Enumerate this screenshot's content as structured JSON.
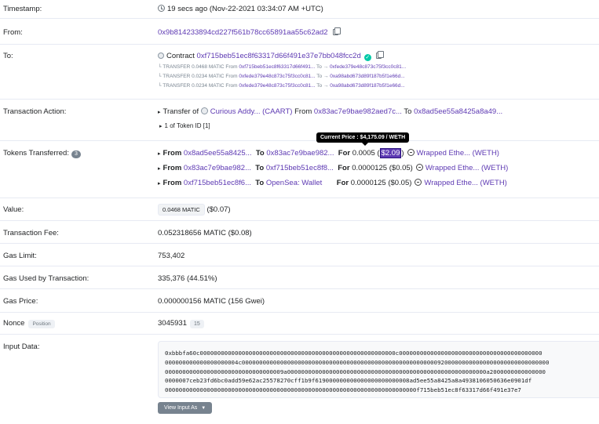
{
  "timestamp": {
    "label": "Timestamp:",
    "value": "19 secs ago (Nov-22-2021 03:34:07 AM +UTC)"
  },
  "from": {
    "label": "From:",
    "address": "0x9b814233894cd227f561b78cc65891aa55c62ad2"
  },
  "to": {
    "label": "To:",
    "prefix": "Contract",
    "address": "0xf715beb51ec8f63317d66f491e37e7bb048fcc2d",
    "transfers": [
      {
        "type": "TRANSFER",
        "amount": "0.0468 MATIC",
        "from_label": "From",
        "from": "0xf715beb51ec8f63317d66f491...",
        "to_label": "To →",
        "to": "0xfede379e48c873c75f3cc0c81..."
      },
      {
        "type": "TRANSFER",
        "amount": "0.0234 MATIC",
        "from_label": "From",
        "from": "0xfede379e48c873c75f3cc0c81...",
        "to_label": "To →",
        "to": "0xa98abd673d89f187b5f1e66d..."
      },
      {
        "type": "TRANSFER",
        "amount": "0.0234 MATIC",
        "from_label": "From",
        "from": "0xfede379e48c873c75f3cc0c81...",
        "to_label": "To →",
        "to": "0xa98abd673d89f187b5f1e66d..."
      }
    ]
  },
  "action": {
    "label": "Transaction Action:",
    "transfer_of": "Transfer of",
    "token": "Curious Addy... (CAART)",
    "from_label": "From",
    "from": "0x83ac7e9bae982aed7c...",
    "to_label": "To",
    "to": "0x8ad5ee55a8425a8a49...",
    "token_id_text": "1 of Token ID [1]"
  },
  "tokens": {
    "label": "Tokens Transferred:",
    "count": "3",
    "tooltip": "Current Price : $4,175.09 / WETH",
    "rows": [
      {
        "from_label": "From",
        "from": "0x8ad5ee55a8425...",
        "to_label": "To",
        "to": "0x83ac7e9bae982...",
        "for_label": "For",
        "amount": "0.0005",
        "usd": "$2.09",
        "token": "Wrapped Ethe...",
        "symbol": "(WETH)"
      },
      {
        "from_label": "From",
        "from": "0x83ac7e9bae982...",
        "to_label": "To",
        "to": "0xf715beb51ec8f8...",
        "for_label": "For",
        "amount": "0.0000125",
        "usd": "($0.05)",
        "token": "Wrapped Ethe...",
        "symbol": "(WETH)"
      },
      {
        "from_label": "From",
        "from": "0xf715beb51ec8f6...",
        "to_label": "To",
        "to": "OpenSea: Wallet",
        "for_label": "For",
        "amount": "0.0000125",
        "usd": "($0.05)",
        "token": "Wrapped Ethe...",
        "symbol": "(WETH)"
      }
    ]
  },
  "value": {
    "label": "Value:",
    "amount": "0.0468 MATIC",
    "usd": "($0.07)"
  },
  "fee": {
    "label": "Transaction Fee:",
    "value": "0.052318656 MATIC ($0.08)"
  },
  "gas_limit": {
    "label": "Gas Limit:",
    "value": "753,402"
  },
  "gas_used": {
    "label": "Gas Used by Transaction:",
    "value": "335,376 (44.51%)"
  },
  "gas_price": {
    "label": "Gas Price:",
    "value": "0.000000156 MATIC (156 Gwei)"
  },
  "nonce": {
    "label": "Nonce",
    "position_tag": "Position",
    "value": "3045931",
    "position": "15"
  },
  "input_data": {
    "label": "Input Data:",
    "lines": [
      "0xbbbfa60c00000000000000000000000000000000000000000000000000000000c00000000000000000000000000000000000000000",
      "000000000000000000004c0000000000000000000000000000000000000000000000000000000092000000000000000000000000000000",
      "0000000000000000000000000000000009a000000000000000000000000000000000000000000000000000000000a2000000000000000",
      "0000007ceb23fd6bc0add59e62ac25578270cff1b9f619000000000000000000000008ad5ee55a8425a8a4938106050636e0901df",
      "000000000000000000000000000000000000000000000000000000000000000000000000f715beb51ec8f63317d66f491e37e7"
    ],
    "button_label": "View Input As"
  },
  "icons": {
    "clock": "clock-icon",
    "copy": "copy-icon",
    "verified": "check-circle-icon",
    "coin": "token-coin-icon",
    "weth": "weth-token-icon"
  }
}
